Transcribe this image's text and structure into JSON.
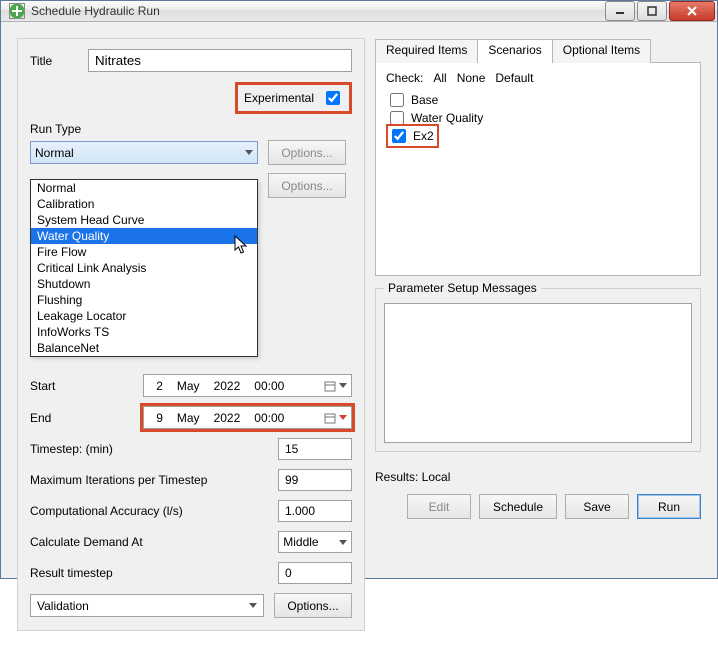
{
  "window": {
    "title": "Schedule Hydraulic Run"
  },
  "left": {
    "title_label": "Title",
    "title_value": "Nitrates",
    "experimental_label": "Experimental",
    "experimental_checked": true,
    "run_type_label": "Run Type",
    "run_type_value": "Normal",
    "options_label": "Options...",
    "run_type_options": [
      "Normal",
      "Calibration",
      "System Head Curve",
      "Water Quality",
      "Fire Flow",
      "Critical Link Analysis",
      "Shutdown",
      "Flushing",
      "Leakage Locator",
      "InfoWorks TS",
      "BalanceNet"
    ],
    "run_type_highlight_index": 3,
    "start_label": "Start",
    "start": {
      "day": "2",
      "month": "May",
      "year": "2022",
      "time": "00:00"
    },
    "end_label": "End",
    "end": {
      "day": "9",
      "month": "May",
      "year": "2022",
      "time": "00:00"
    },
    "timestep_label": "Timestep: (min)",
    "timestep_value": "15",
    "maxiter_label": "Maximum Iterations per Timestep",
    "maxiter_value": "99",
    "comp_acc_label": "Computational Accuracy (l/s)",
    "comp_acc_value": "1.000",
    "calc_demand_label": "Calculate Demand At",
    "calc_demand_value": "Middle",
    "result_ts_label": "Result timestep",
    "result_ts_value": "0",
    "validation_value": "Validation"
  },
  "right": {
    "tabs": [
      "Required Items",
      "Scenarios",
      "Optional Items"
    ],
    "active_tab_index": 1,
    "check_label": "Check:",
    "check_links": [
      "All",
      "None",
      "Default"
    ],
    "scenarios": [
      {
        "name": "Base",
        "checked": false,
        "highlight": false
      },
      {
        "name": "Water Quality",
        "checked": false,
        "highlight": false
      },
      {
        "name": "Ex2",
        "checked": true,
        "highlight": true
      }
    ],
    "param_msgs_label": "Parameter Setup Messages",
    "results_label": "Results: Local",
    "buttons": {
      "edit": "Edit",
      "schedule": "Schedule",
      "save": "Save",
      "run": "Run"
    }
  }
}
